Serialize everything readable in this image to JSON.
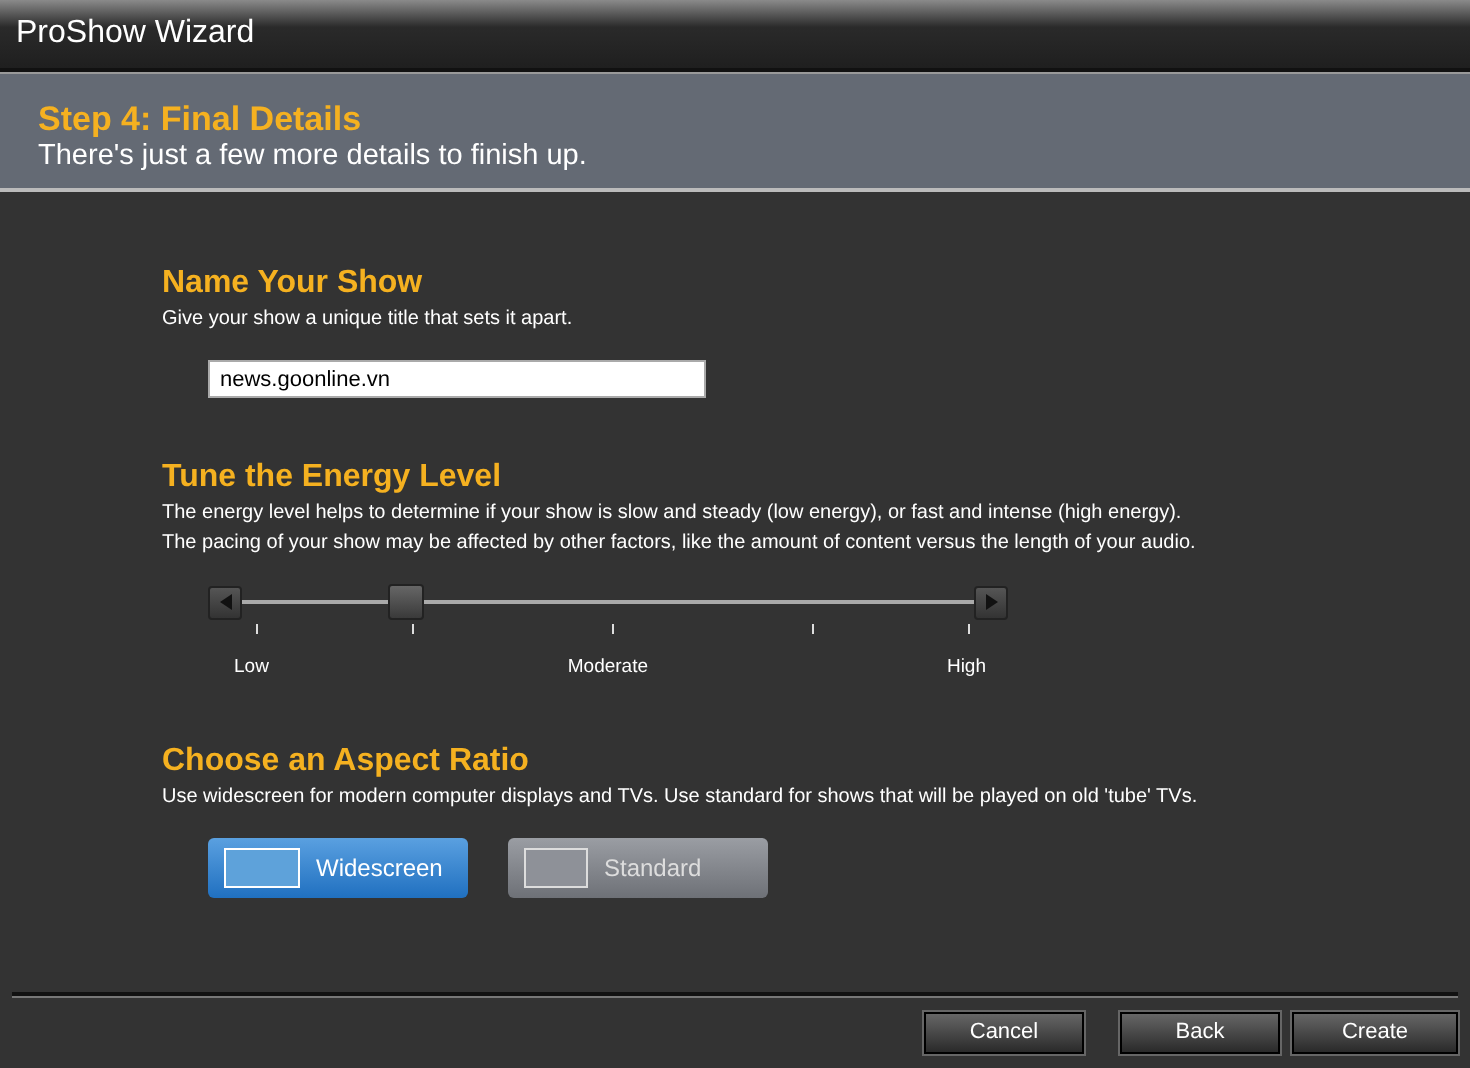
{
  "window": {
    "title": "ProShow Wizard"
  },
  "header": {
    "title": "Step 4: Final Details",
    "subtitle": "There's just a few more details to finish up."
  },
  "name_section": {
    "title": "Name Your Show",
    "description": "Give your show a unique title that sets it apart.",
    "value": "news.goonline.vn"
  },
  "energy_section": {
    "title": "Tune the Energy Level",
    "description": [
      "The energy level helps to determine if your show is slow and steady (low energy), or fast and intense (high energy).",
      "The pacing of your show may be affected by other factors, like the amount of content versus the length of your audio."
    ],
    "level": 0.22,
    "labels": [
      "Low",
      "Moderate",
      "High"
    ]
  },
  "aspect_section": {
    "title": "Choose an Aspect Ratio",
    "description": "Use widescreen for modern computer displays and TVs. Use standard for shows that will be played on old 'tube' TVs.",
    "options": [
      {
        "label": "Widescreen",
        "kind": "wide",
        "selected": true
      },
      {
        "label": "Standard",
        "kind": "standard",
        "selected": false
      }
    ]
  },
  "buttons": [
    "Cancel",
    "Back",
    "Create"
  ]
}
